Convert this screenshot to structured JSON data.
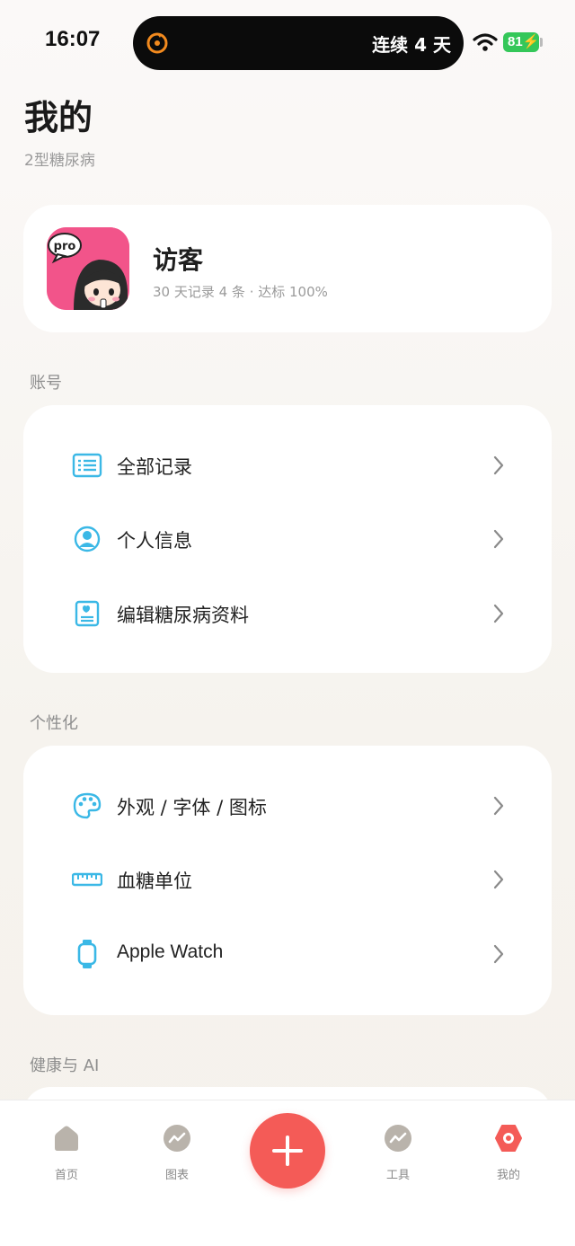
{
  "status_bar": {
    "time": "16:07",
    "island_text": "连续 4 天",
    "battery": "81"
  },
  "header": {
    "title": "我的",
    "subtitle": "2型糖尿病"
  },
  "profile": {
    "name": "访客",
    "stats": "30 天记录 4 条 · 达标 100%",
    "avatar_badge": "pro"
  },
  "sections": {
    "account": {
      "label": "账号",
      "items": [
        {
          "label": "全部记录",
          "icon": "records-list-icon"
        },
        {
          "label": "个人信息",
          "icon": "user-circle-icon"
        },
        {
          "label": "编辑糖尿病资料",
          "icon": "profile-card-icon"
        }
      ]
    },
    "personalize": {
      "label": "个性化",
      "items": [
        {
          "label": "外观 / 字体 / 图标",
          "icon": "palette-icon"
        },
        {
          "label": "血糖单位",
          "icon": "ruler-icon"
        },
        {
          "label": "Apple Watch",
          "icon": "watch-icon"
        }
      ]
    },
    "health_ai": {
      "label": "健康与 AI"
    }
  },
  "tabbar": {
    "items": [
      {
        "label": "首页",
        "icon": "home-icon"
      },
      {
        "label": "图表",
        "icon": "chart-icon"
      },
      {
        "label": "",
        "icon": "plus-icon"
      },
      {
        "label": "工具",
        "icon": "tools-icon"
      },
      {
        "label": "我的",
        "icon": "profile-tab-icon"
      }
    ]
  },
  "colors": {
    "accent": "#f45b57",
    "icon_blue": "#3bb8e6",
    "tab_inactive": "#b9b3ab",
    "battery": "#34c759"
  }
}
